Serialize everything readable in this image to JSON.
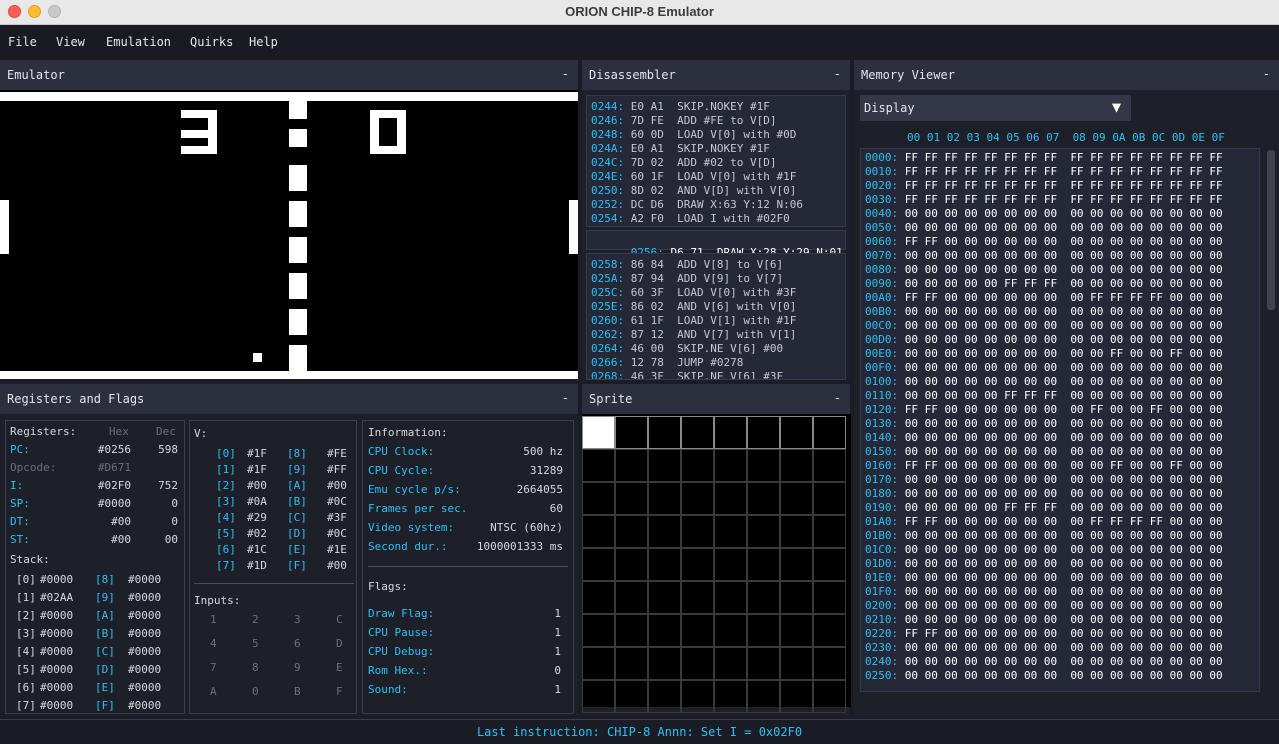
{
  "window": {
    "title": "ORION CHIP-8 Emulator"
  },
  "menu": [
    "File",
    "View",
    "Emulation",
    "Quirks",
    "Help"
  ],
  "panels": {
    "emulator": {
      "title": "Emulator",
      "collapse": "-"
    },
    "disassembler": {
      "title": "Disassembler",
      "collapse": "-"
    },
    "memory": {
      "title": "Memory Viewer",
      "collapse": "-"
    },
    "registers": {
      "title": "Registers and Flags",
      "collapse": "-"
    },
    "sprite": {
      "title": "Sprite",
      "collapse": "-"
    }
  },
  "disassembler": {
    "before": [
      {
        "addr": "0244:",
        "text": "E0 A1  SKIP.NOKEY #1F"
      },
      {
        "addr": "0246:",
        "text": "7D FE  ADD #FE to V[D]"
      },
      {
        "addr": "0248:",
        "text": "60 0D  LOAD V[0] with #0D"
      },
      {
        "addr": "024A:",
        "text": "E0 A1  SKIP.NOKEY #1F"
      },
      {
        "addr": "024C:",
        "text": "7D 02  ADD #02 to V[D]"
      },
      {
        "addr": "024E:",
        "text": "60 1F  LOAD V[0] with #1F"
      },
      {
        "addr": "0250:",
        "text": "8D 02  AND V[D] with V[0]"
      },
      {
        "addr": "0252:",
        "text": "DC D6  DRAW X:63 Y:12 N:06"
      },
      {
        "addr": "0254:",
        "text": "A2 F0  LOAD I with #02F0"
      }
    ],
    "current": {
      "addr": "0256:",
      "text": "D6 71  DRAW X:28 Y:29 N:01"
    },
    "after": [
      {
        "addr": "0258:",
        "text": "86 84  ADD V[8] to V[6]"
      },
      {
        "addr": "025A:",
        "text": "87 94  ADD V[9] to V[7]"
      },
      {
        "addr": "025C:",
        "text": "60 3F  LOAD V[0] with #3F"
      },
      {
        "addr": "025E:",
        "text": "86 02  AND V[6] with V[0]"
      },
      {
        "addr": "0260:",
        "text": "61 1F  LOAD V[1] with #1F"
      },
      {
        "addr": "0262:",
        "text": "87 12  AND V[7] with V[1]"
      },
      {
        "addr": "0264:",
        "text": "46 00  SKIP.NE V[6] #00"
      },
      {
        "addr": "0266:",
        "text": "12 78  JUMP #0278"
      },
      {
        "addr": "0268:",
        "text": "46 3F  SKIP.NE V[6] #3F"
      }
    ]
  },
  "registers": {
    "label": "Registers:",
    "hex_header": "Hex",
    "dec_header": "Dec",
    "rows": [
      {
        "name": "PC:",
        "hex": "#0256",
        "dec": "598",
        "dim": false
      },
      {
        "name": "Opcode:",
        "hex": "#D671",
        "dec": "",
        "dim": true
      },
      {
        "name": "I:",
        "hex": "#02F0",
        "dec": "752",
        "dim": false
      },
      {
        "name": "SP:",
        "hex": "#0000",
        "dec": "0",
        "dim": false
      },
      {
        "name": "DT:",
        "hex": "#00",
        "dec": "0",
        "dim": false
      },
      {
        "name": "ST:",
        "hex": "#00",
        "dec": "00",
        "dim": false
      }
    ],
    "stack_label": "Stack:",
    "stack": [
      {
        "i": "[0]",
        "v": "#0000",
        "j": "[8]",
        "w": "#0000"
      },
      {
        "i": "[1]",
        "v": "#02AA",
        "j": "[9]",
        "w": "#0000"
      },
      {
        "i": "[2]",
        "v": "#0000",
        "j": "[A]",
        "w": "#0000"
      },
      {
        "i": "[3]",
        "v": "#0000",
        "j": "[B]",
        "w": "#0000"
      },
      {
        "i": "[4]",
        "v": "#0000",
        "j": "[C]",
        "w": "#0000"
      },
      {
        "i": "[5]",
        "v": "#0000",
        "j": "[D]",
        "w": "#0000"
      },
      {
        "i": "[6]",
        "v": "#0000",
        "j": "[E]",
        "w": "#0000"
      },
      {
        "i": "[7]",
        "v": "#0000",
        "j": "[F]",
        "w": "#0000"
      }
    ],
    "v_label": "V:",
    "v": [
      {
        "i": "[0]",
        "v": "#1F",
        "j": "[8]",
        "w": "#FE"
      },
      {
        "i": "[1]",
        "v": "#1F",
        "j": "[9]",
        "w": "#FF"
      },
      {
        "i": "[2]",
        "v": "#00",
        "j": "[A]",
        "w": "#00"
      },
      {
        "i": "[3]",
        "v": "#0A",
        "j": "[B]",
        "w": "#0C"
      },
      {
        "i": "[4]",
        "v": "#29",
        "j": "[C]",
        "w": "#3F"
      },
      {
        "i": "[5]",
        "v": "#02",
        "j": "[D]",
        "w": "#0C"
      },
      {
        "i": "[6]",
        "v": "#1C",
        "j": "[E]",
        "w": "#1E"
      },
      {
        "i": "[7]",
        "v": "#1D",
        "j": "[F]",
        "w": "#00"
      }
    ],
    "inputs_label": "Inputs:",
    "inputs": [
      "1",
      "2",
      "3",
      "C",
      "4",
      "5",
      "6",
      "D",
      "7",
      "8",
      "9",
      "E",
      "A",
      "0",
      "B",
      "F"
    ]
  },
  "information": {
    "label": "Information:",
    "rows": [
      {
        "name": "CPU Clock:",
        "value": "500 hz"
      },
      {
        "name": "CPU Cycle:",
        "value": "31289"
      },
      {
        "name": "Emu cycle p/s:",
        "value": "2664055"
      },
      {
        "name": "Frames per sec.",
        "value": "60"
      },
      {
        "name": "Video system:",
        "value": "NTSC (60hz)"
      },
      {
        "name": "Second dur.:",
        "value": "1000001333 ms"
      }
    ]
  },
  "flags": {
    "label": "Flags:",
    "rows": [
      {
        "name": "Draw Flag:",
        "value": "1"
      },
      {
        "name": "CPU Pause:",
        "value": "1"
      },
      {
        "name": "CPU Debug:",
        "value": "1"
      },
      {
        "name": "Rom Hex.:",
        "value": "0"
      },
      {
        "name": "Sound:",
        "value": "1"
      }
    ]
  },
  "memory": {
    "dropdown_value": "Display",
    "dropdown_arrow": "▼",
    "header": "00 01 02 03 04 05 06 07  08 09 0A 0B 0C 0D 0E 0F",
    "rows": [
      {
        "addr": "0000:",
        "bytes": "FF FF FF FF FF FF FF FF  FF FF FF FF FF FF FF FF"
      },
      {
        "addr": "0010:",
        "bytes": "FF FF FF FF FF FF FF FF  FF FF FF FF FF FF FF FF"
      },
      {
        "addr": "0020:",
        "bytes": "FF FF FF FF FF FF FF FF  FF FF FF FF FF FF FF FF"
      },
      {
        "addr": "0030:",
        "bytes": "FF FF FF FF FF FF FF FF  FF FF FF FF FF FF FF FF"
      },
      {
        "addr": "0040:",
        "bytes": "00 00 00 00 00 00 00 00  00 00 00 00 00 00 00 00"
      },
      {
        "addr": "0050:",
        "bytes": "00 00 00 00 00 00 00 00  00 00 00 00 00 00 00 00"
      },
      {
        "addr": "0060:",
        "bytes": "FF FF 00 00 00 00 00 00  00 00 00 00 00 00 00 00"
      },
      {
        "addr": "0070:",
        "bytes": "00 00 00 00 00 00 00 00  00 00 00 00 00 00 00 00"
      },
      {
        "addr": "0080:",
        "bytes": "00 00 00 00 00 00 00 00  00 00 00 00 00 00 00 00"
      },
      {
        "addr": "0090:",
        "bytes": "00 00 00 00 00 FF FF FF  00 00 00 00 00 00 00 00"
      },
      {
        "addr": "00A0:",
        "bytes": "FF FF 00 00 00 00 00 00  00 FF FF FF FF 00 00 00"
      },
      {
        "addr": "00B0:",
        "bytes": "00 00 00 00 00 00 00 00  00 00 00 00 00 00 00 00"
      },
      {
        "addr": "00C0:",
        "bytes": "00 00 00 00 00 00 00 00  00 00 00 00 00 00 00 00"
      },
      {
        "addr": "00D0:",
        "bytes": "00 00 00 00 00 00 00 00  00 00 00 00 00 00 00 00"
      },
      {
        "addr": "00E0:",
        "bytes": "00 00 00 00 00 00 00 00  00 00 FF 00 00 FF 00 00"
      },
      {
        "addr": "00F0:",
        "bytes": "00 00 00 00 00 00 00 00  00 00 00 00 00 00 00 00"
      },
      {
        "addr": "0100:",
        "bytes": "00 00 00 00 00 00 00 00  00 00 00 00 00 00 00 00"
      },
      {
        "addr": "0110:",
        "bytes": "00 00 00 00 00 FF FF FF  00 00 00 00 00 00 00 00"
      },
      {
        "addr": "0120:",
        "bytes": "FF FF 00 00 00 00 00 00  00 FF 00 00 FF 00 00 00"
      },
      {
        "addr": "0130:",
        "bytes": "00 00 00 00 00 00 00 00  00 00 00 00 00 00 00 00"
      },
      {
        "addr": "0140:",
        "bytes": "00 00 00 00 00 00 00 00  00 00 00 00 00 00 00 00"
      },
      {
        "addr": "0150:",
        "bytes": "00 00 00 00 00 00 00 00  00 00 00 00 00 00 00 00"
      },
      {
        "addr": "0160:",
        "bytes": "FF FF 00 00 00 00 00 00  00 00 FF 00 00 FF 00 00"
      },
      {
        "addr": "0170:",
        "bytes": "00 00 00 00 00 00 00 00  00 00 00 00 00 00 00 00"
      },
      {
        "addr": "0180:",
        "bytes": "00 00 00 00 00 00 00 00  00 00 00 00 00 00 00 00"
      },
      {
        "addr": "0190:",
        "bytes": "00 00 00 00 00 FF FF FF  00 00 00 00 00 00 00 00"
      },
      {
        "addr": "01A0:",
        "bytes": "FF FF 00 00 00 00 00 00  00 FF FF FF FF 00 00 00"
      },
      {
        "addr": "01B0:",
        "bytes": "00 00 00 00 00 00 00 00  00 00 00 00 00 00 00 00"
      },
      {
        "addr": "01C0:",
        "bytes": "00 00 00 00 00 00 00 00  00 00 00 00 00 00 00 00"
      },
      {
        "addr": "01D0:",
        "bytes": "00 00 00 00 00 00 00 00  00 00 00 00 00 00 00 00"
      },
      {
        "addr": "01E0:",
        "bytes": "00 00 00 00 00 00 00 00  00 00 00 00 00 00 00 00"
      },
      {
        "addr": "01F0:",
        "bytes": "00 00 00 00 00 00 00 00  00 00 00 00 00 00 00 00"
      },
      {
        "addr": "0200:",
        "bytes": "00 00 00 00 00 00 00 00  00 00 00 00 00 00 00 00"
      },
      {
        "addr": "0210:",
        "bytes": "00 00 00 00 00 00 00 00  00 00 00 00 00 00 00 00"
      },
      {
        "addr": "0220:",
        "bytes": "FF FF 00 00 00 00 00 00  00 00 00 00 00 00 00 00"
      },
      {
        "addr": "0230:",
        "bytes": "00 00 00 00 00 00 00 00  00 00 00 00 00 00 00 00"
      },
      {
        "addr": "0240:",
        "bytes": "00 00 00 00 00 00 00 00  00 00 00 00 00 00 00 00"
      },
      {
        "addr": "0250:",
        "bytes": "00 00 00 00 00 00 00 00  00 00 00 00 00 00 00 00"
      }
    ]
  },
  "status": {
    "text": "Last instruction: CHIP-8 Annn: Set I = 0x02F0"
  }
}
